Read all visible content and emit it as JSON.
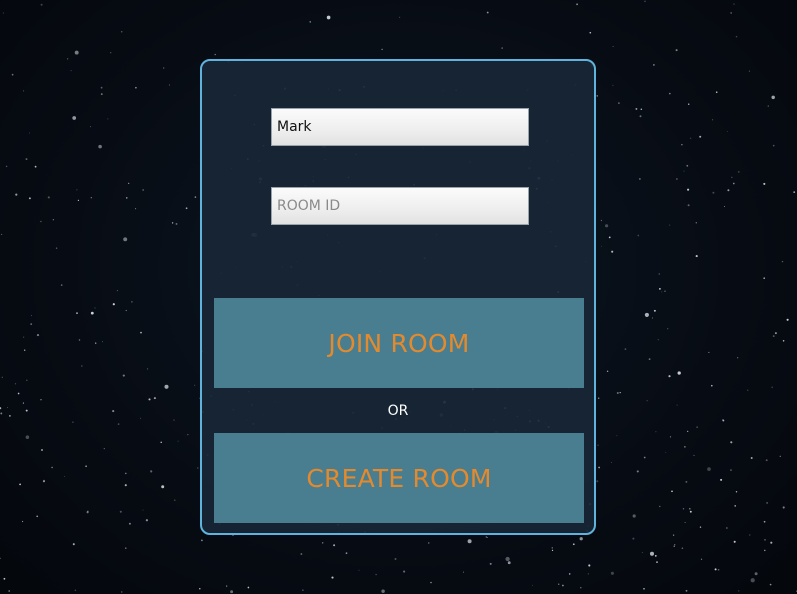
{
  "login_panel": {
    "name_field": {
      "value": "Mark",
      "placeholder": ""
    },
    "room_id_field": {
      "value": "",
      "placeholder": "ROOM ID"
    },
    "join_button_label": "JOIN ROOM",
    "separator_text": "OR",
    "create_button_label": "CREATE ROOM"
  },
  "colors": {
    "background": "#070c14",
    "panel_background": "#182636",
    "panel_border": "#5fb3dd",
    "button_background": "#487e90",
    "button_text": "#e48a2e",
    "separator_text": "#ffffff"
  }
}
